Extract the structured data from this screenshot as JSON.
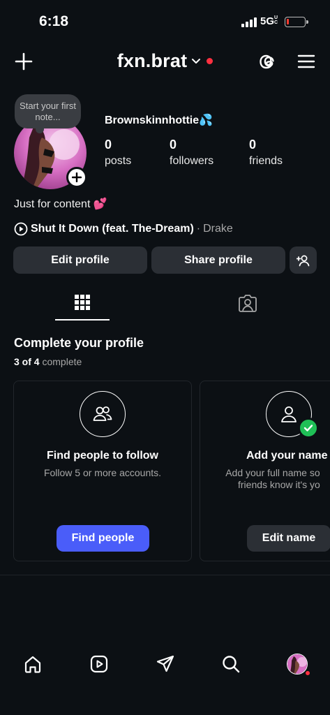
{
  "status_bar": {
    "time": "6:18",
    "network": "5G",
    "network_suffix": "UC",
    "signal_bars": 4,
    "battery_level": 0.1
  },
  "header": {
    "username": "fxn.brat",
    "notification_color": "#ff3040"
  },
  "profile": {
    "note_placeholder": "Start your first note...",
    "display_name": "Brownskinnhottie💦",
    "stats": [
      {
        "value": "0",
        "label": "posts"
      },
      {
        "value": "0",
        "label": "followers"
      },
      {
        "value": "0",
        "label": "friends"
      }
    ],
    "bio": "Just for content 💕",
    "music": {
      "title": "Shut It Down (feat. The-Dream)",
      "separator": "·",
      "artist": "Drake"
    }
  },
  "actions": {
    "edit_profile": "Edit profile",
    "share_profile": "Share profile"
  },
  "tabs": [
    {
      "name": "grid",
      "icon": "grid-icon",
      "active": true
    },
    {
      "name": "tagged",
      "icon": "tagged-icon",
      "active": false
    }
  ],
  "complete_profile": {
    "title": "Complete your profile",
    "progress_count": "3 of 4",
    "progress_word": "complete",
    "cards": [
      {
        "icon": "people-icon",
        "title": "Find people to follow",
        "desc": "Follow 5 or more accounts.",
        "button": "Find people",
        "done": false
      },
      {
        "icon": "person-icon",
        "title": "Add your name",
        "desc_line1": "Add your full name so",
        "desc_line2": "friends know it's yo",
        "button": "Edit name",
        "done": true
      }
    ]
  },
  "bottom_nav": [
    "home-icon",
    "reels-icon",
    "messages-icon",
    "search-icon",
    "profile-avatar"
  ],
  "colors": {
    "background": "#0c1014",
    "button_bg": "#2b2f35",
    "primary_blue": "#4a5df9",
    "success_green": "#1fbf56"
  }
}
